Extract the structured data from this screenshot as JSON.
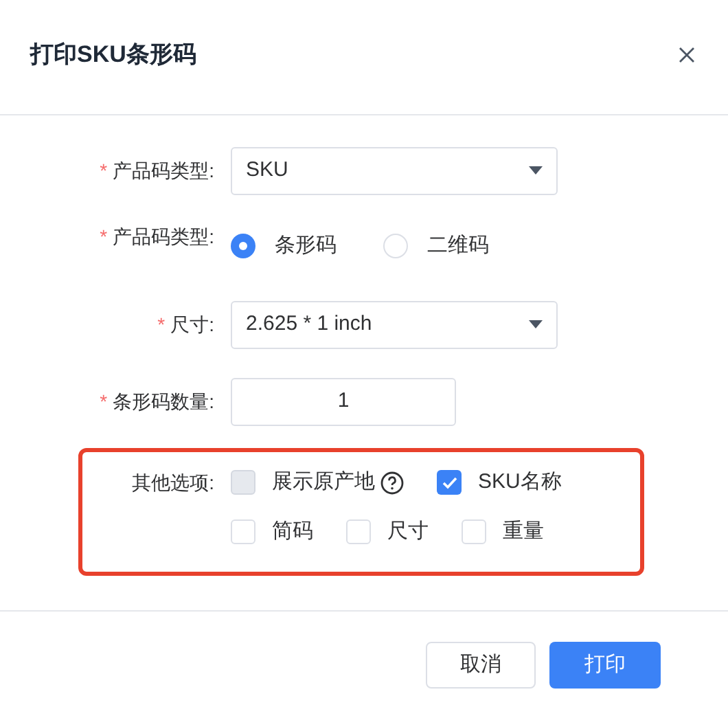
{
  "dialog": {
    "title": "打印SKU条形码"
  },
  "fields": [
    {
      "kind": "select",
      "marker": "*",
      "label": "产品码类型:",
      "value": "SKU"
    },
    {
      "kind": "radio",
      "marker": "*",
      "label": "产品码类型:",
      "options": [
        {
          "label": "条形码",
          "selected": true
        },
        {
          "label": "二维码",
          "selected": false
        }
      ]
    },
    {
      "kind": "select",
      "marker": "*",
      "label": "尺寸:",
      "value": "2.625 * 1 inch"
    },
    {
      "kind": "number",
      "marker": "*",
      "label": "条形码数量:",
      "value": "1"
    }
  ],
  "other_options": {
    "label": "其他选项:",
    "highlighted": true,
    "items": [
      {
        "label": "展示原产地",
        "checked": false,
        "disabled": true,
        "help": true
      },
      {
        "label": "SKU名称",
        "checked": true,
        "disabled": false
      },
      {
        "label": "简码",
        "checked": false,
        "disabled": false
      },
      {
        "label": "尺寸",
        "checked": false,
        "disabled": false
      },
      {
        "label": "重量",
        "checked": false,
        "disabled": false
      }
    ]
  },
  "buttons": [
    {
      "label": "取消",
      "kind": "secondary"
    },
    {
      "label": "打印",
      "kind": "primary"
    }
  ]
}
